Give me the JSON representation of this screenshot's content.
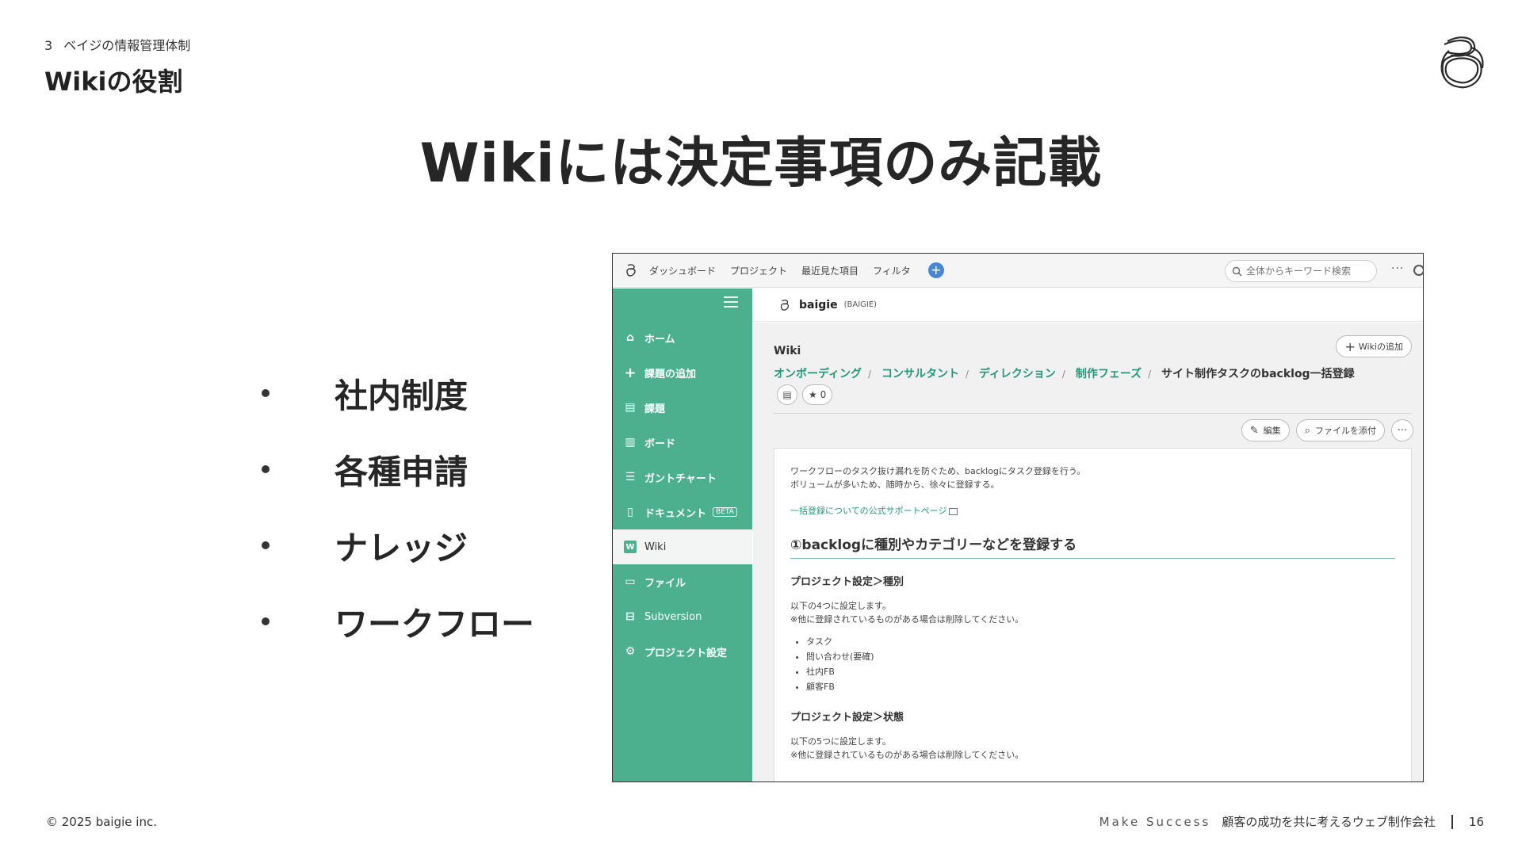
{
  "header": {
    "section_number": "3",
    "section_title": "ベイジの情報管理体制",
    "heading": "Wikiの役割"
  },
  "title": "Wikiには決定事項のみ記載",
  "bullets": [
    "社内制度",
    "各種申請",
    "ナレッジ",
    "ワークフロー"
  ],
  "footer": {
    "copyright": "© 2025 baigie inc.",
    "motto": "Make Success",
    "tagline": "顧客の成功を共に考えるウェブ制作会社",
    "page_number": "16"
  },
  "screenshot": {
    "topbar": {
      "nav": [
        "ダッシュボード",
        "プロジェクト",
        "最近見た項目",
        "フィルタ"
      ],
      "search_placeholder": "全体からキーワード検索",
      "more": "···"
    },
    "sidebar": {
      "items": [
        {
          "label": "ホーム",
          "icon": "home-icon"
        },
        {
          "label": "課題の追加",
          "icon": "plus-icon"
        },
        {
          "label": "課題",
          "icon": "list-icon"
        },
        {
          "label": "ボード",
          "icon": "board-icon"
        },
        {
          "label": "ガントチャート",
          "icon": "gantt-icon"
        },
        {
          "label": "ドキュメント",
          "icon": "document-icon",
          "badge": "BETA"
        },
        {
          "label": "Wiki",
          "icon": "wiki-icon",
          "active": true
        },
        {
          "label": "ファイル",
          "icon": "file-icon"
        },
        {
          "label": "Subversion",
          "icon": "subversion-icon"
        },
        {
          "label": "プロジェクト設定",
          "icon": "gear-icon"
        }
      ]
    },
    "project": {
      "name": "baigie",
      "key": "(BAIGIE)"
    },
    "wiki": {
      "label": "Wiki",
      "add_button": "Wikiの追加",
      "breadcrumbs": [
        "オンボーディング",
        "コンサルタント",
        "ディレクション",
        "制作フェーズ"
      ],
      "current_page": "サイト制作タスクのbacklog一括登録",
      "star_count": "0",
      "edit_button": "編集",
      "attach_button": "ファイルを添付",
      "more": "···"
    },
    "document": {
      "intro_1": "ワークフローのタスク抜け漏れを防ぐため、backlogにタスク登録を行う。",
      "intro_2": "ボリュームが多いため、随時から、徐々に登録する。",
      "support_link": "一括登録についての公式サポートページ",
      "heading": "①backlogに種別やカテゴリーなどを登録する",
      "section1_title": "プロジェクト設定＞種別",
      "section1_line1": "以下の4つに設定します。",
      "section1_line2": "※他に登録されているものがある場合は削除してください。",
      "section1_items": [
        "タスク",
        "問い合わせ(要確)",
        "社内FB",
        "顧客FB"
      ],
      "section2_title": "プロジェクト設定＞状態",
      "section2_line1": "以下の5つに設定します。",
      "section2_line2": "※他に登録されているものがある場合は削除してください。"
    }
  }
}
